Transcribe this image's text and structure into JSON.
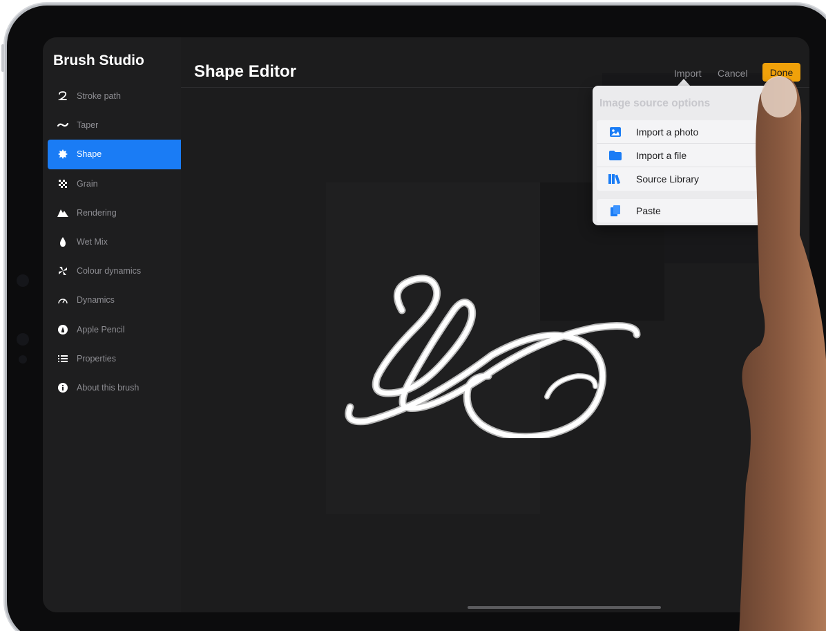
{
  "sidebar": {
    "title": "Brush Studio",
    "items": [
      {
        "label": "Stroke path",
        "icon": "stroke-path-icon"
      },
      {
        "label": "Taper",
        "icon": "taper-icon"
      },
      {
        "label": "Shape",
        "icon": "shape-icon",
        "active": true
      },
      {
        "label": "Grain",
        "icon": "grain-icon"
      },
      {
        "label": "Rendering",
        "icon": "rendering-icon"
      },
      {
        "label": "Wet Mix",
        "icon": "wet-mix-icon"
      },
      {
        "label": "Colour dynamics",
        "icon": "colour-dynamics-icon"
      },
      {
        "label": "Dynamics",
        "icon": "dynamics-icon"
      },
      {
        "label": "Apple Pencil",
        "icon": "apple-pencil-icon"
      },
      {
        "label": "Properties",
        "icon": "properties-icon"
      },
      {
        "label": "About this brush",
        "icon": "info-icon"
      }
    ]
  },
  "header": {
    "title": "Shape Editor",
    "import_label": "Import",
    "cancel_label": "Cancel",
    "done_label": "Done"
  },
  "popover": {
    "title": "Image source options",
    "items": [
      {
        "label": "Import a photo",
        "icon": "photo-icon"
      },
      {
        "label": "Import a file",
        "icon": "folder-icon"
      },
      {
        "label": "Source Library",
        "icon": "library-icon"
      }
    ],
    "paste_label": "Paste",
    "paste_icon": "paste-icon"
  },
  "colors": {
    "accent_blue": "#1a7cf5",
    "done_orange": "#f0a10a",
    "background": "#1c1c1d"
  }
}
